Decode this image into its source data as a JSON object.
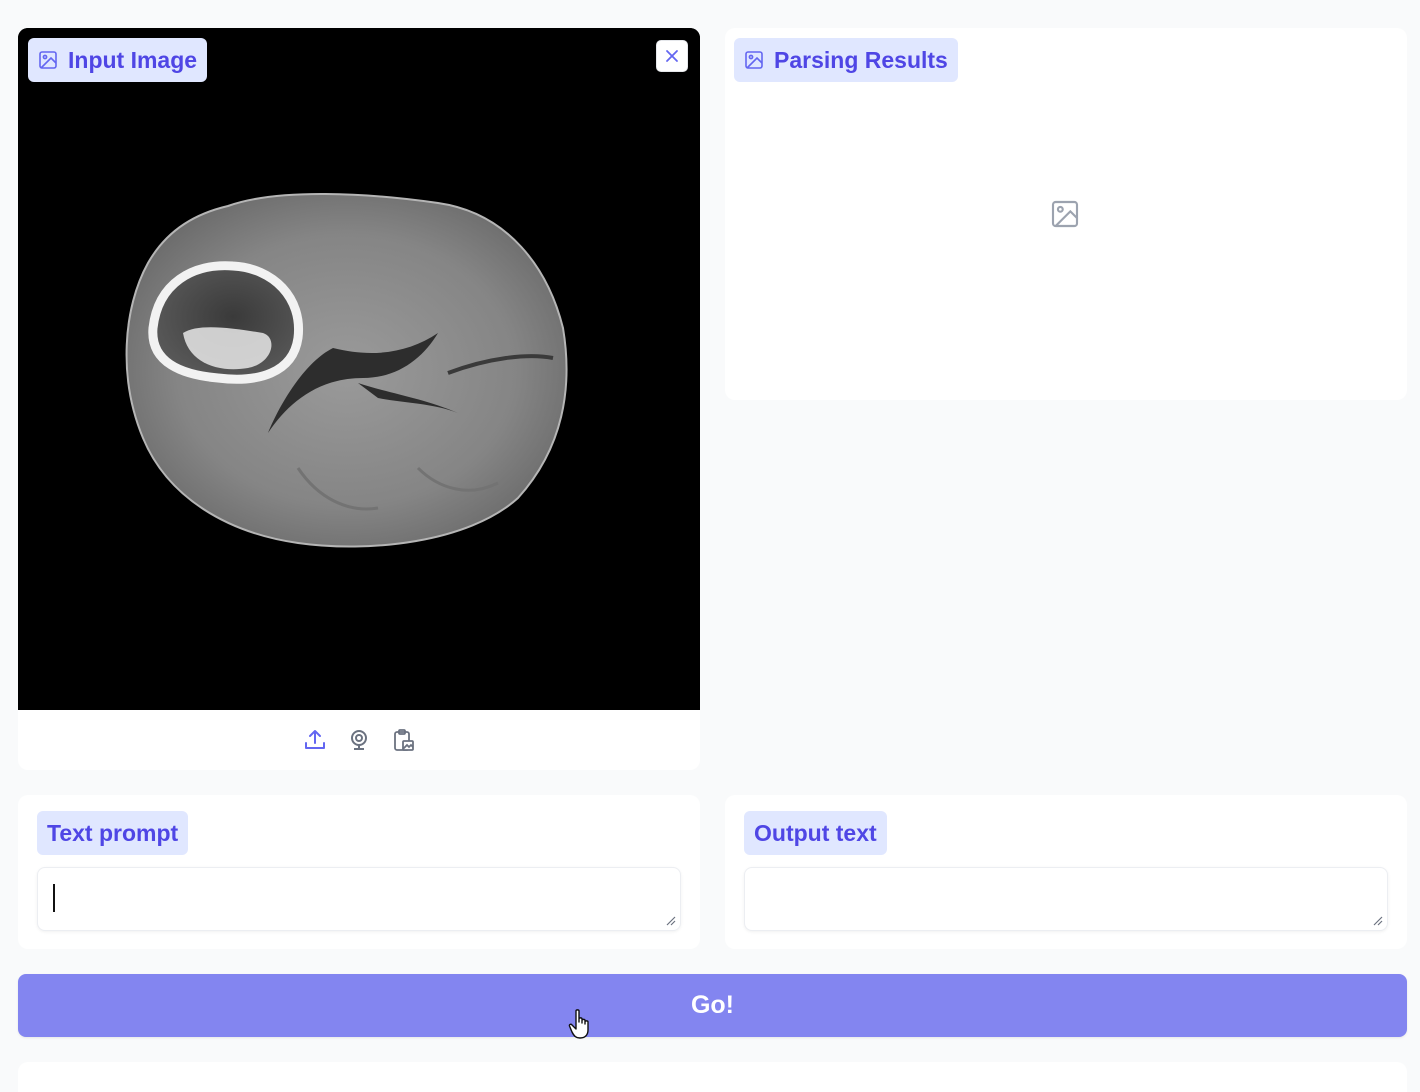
{
  "input_panel": {
    "label": "Input Image",
    "image_alt": "brain MRI scan",
    "toolbar": [
      "upload-icon",
      "webcam-icon",
      "clipboard-image-icon"
    ]
  },
  "result_panel": {
    "label": "Parsing Results",
    "placeholder_icon": "image-icon"
  },
  "prompt_panel": {
    "label": "Text prompt",
    "value": "",
    "placeholder": ""
  },
  "output_panel": {
    "label": "Output text",
    "value": ""
  },
  "submit": {
    "label": "Go!"
  },
  "colors": {
    "accent": "#8385f0",
    "chip_bg": "#e0e7ff",
    "chip_text": "#4f46e5"
  }
}
